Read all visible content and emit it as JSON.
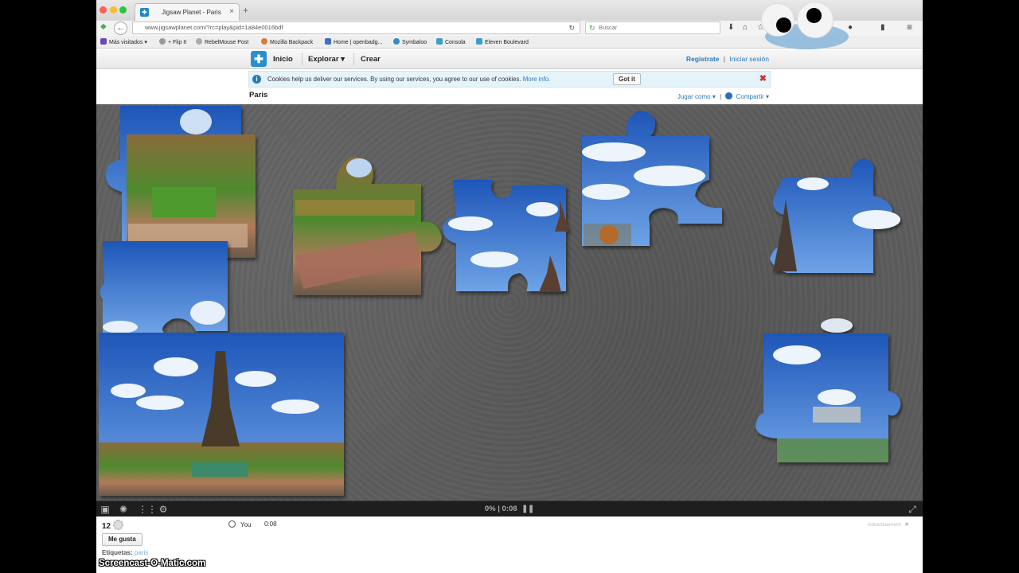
{
  "browser": {
    "tab_title": "Jigsaw Planet - Paris",
    "url": "www.jigsawplanet.com/?rc=play&pid=1a84e0016bdf",
    "search_placeholder": "Buscar",
    "bookmarks": [
      {
        "label": "Más visitados ▾",
        "color": "#6d4bb3"
      },
      {
        "label": "+ Flip It",
        "color": "#9a9a9a"
      },
      {
        "label": "RebelMouse Post",
        "color": "#aaaaaa"
      },
      {
        "label": "Mozilla Backpack",
        "color": "#e07a2f"
      },
      {
        "label": "Home | openbadg...",
        "color": "#3f6fbf"
      },
      {
        "label": "Symbaloo",
        "color": "#2a8fd0"
      },
      {
        "label": "Consola",
        "color": "#3aa0c8"
      },
      {
        "label": "Eleven Boulevard",
        "color": "#3aa0c8"
      }
    ]
  },
  "site": {
    "nav": [
      "Inicio",
      "Explorar ▾",
      "Crear"
    ],
    "register": "Registrate",
    "separator": "|",
    "login": "Iniciar sesión",
    "accent": "#2a7ab8"
  },
  "cookie": {
    "message": "Cookies help us deliver our services. By using our services, you agree to our use of cookies.",
    "more": "More info.",
    "button": "Got it"
  },
  "puzzle": {
    "title": "Paris",
    "play_as": "Jugar como ▾",
    "share": "Compartir ▾",
    "progress_percent": 0,
    "progress_text": "0% | 0:08",
    "pieces_count": "12",
    "player_name": "You",
    "player_time": "0:08",
    "like_label": "Me gusta",
    "tags_label": "Etiquetas:",
    "tag": "paris",
    "advertisement": "Advertisement"
  },
  "watermark": "Screencast-O-Matic.com"
}
